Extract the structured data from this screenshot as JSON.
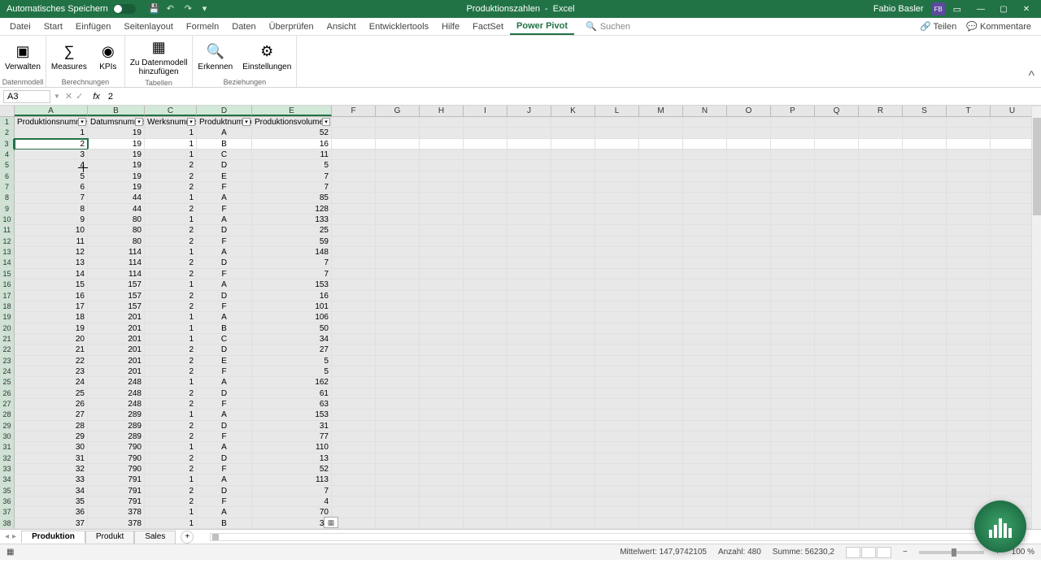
{
  "titlebar": {
    "autosave_label": "Automatisches Speichern",
    "doc_name": "Produktionszahlen",
    "app_name": "Excel",
    "user_name": "Fabio Basler",
    "user_initials": "FB"
  },
  "menu": {
    "items": [
      "Datei",
      "Start",
      "Einfügen",
      "Seitenlayout",
      "Formeln",
      "Daten",
      "Überprüfen",
      "Ansicht",
      "Entwicklertools",
      "Hilfe",
      "FactSet",
      "Power Pivot"
    ],
    "active": "Power Pivot",
    "search": "Suchen",
    "share": "Teilen",
    "comments": "Kommentare"
  },
  "ribbon": {
    "groups": [
      {
        "label": "Datenmodell",
        "buttons": [
          {
            "label": "Verwalten",
            "icon": "cube"
          }
        ]
      },
      {
        "label": "Berechnungen",
        "buttons": [
          {
            "label": "Measures",
            "icon": "calc"
          },
          {
            "label": "KPIs",
            "icon": "kpi"
          }
        ]
      },
      {
        "label": "Tabellen",
        "buttons": [
          {
            "label": "Zu Datenmodell\nhinzufügen",
            "icon": "table"
          }
        ]
      },
      {
        "label": "Beziehungen",
        "buttons": [
          {
            "label": "Erkennen",
            "icon": "detect"
          },
          {
            "label": "Einstellungen",
            "icon": "gear"
          }
        ]
      }
    ]
  },
  "formula": {
    "cell_ref": "A3",
    "value": "2"
  },
  "columns_data": [
    "A",
    "B",
    "C",
    "D",
    "E"
  ],
  "columns_blank": [
    "F",
    "G",
    "H",
    "I",
    "J",
    "K",
    "L",
    "M",
    "N",
    "O",
    "P",
    "Q",
    "R",
    "S",
    "T",
    "U"
  ],
  "col_widths": {
    "A": 90,
    "B": 70,
    "C": 64,
    "D": 68,
    "E": 98,
    "default": 54
  },
  "headers": [
    "Produktionsnummer",
    "Datumsnummer",
    "Werksnummer",
    "Produktnummer",
    "Produktionsvolumen"
  ],
  "active_row": 3,
  "chart_data": {
    "type": "table",
    "columns": [
      "Produktionsnummer",
      "Datumsnummer",
      "Werksnummer",
      "Produktnummer",
      "Produktionsvolumen"
    ],
    "rows": [
      [
        1,
        19,
        1,
        "A",
        52
      ],
      [
        2,
        19,
        1,
        "B",
        16
      ],
      [
        3,
        19,
        1,
        "C",
        11
      ],
      [
        4,
        19,
        2,
        "D",
        5
      ],
      [
        5,
        19,
        2,
        "E",
        7
      ],
      [
        6,
        19,
        2,
        "F",
        7
      ],
      [
        7,
        44,
        1,
        "A",
        85
      ],
      [
        8,
        44,
        2,
        "F",
        128
      ],
      [
        9,
        80,
        1,
        "A",
        133
      ],
      [
        10,
        80,
        2,
        "D",
        25
      ],
      [
        11,
        80,
        2,
        "F",
        59
      ],
      [
        12,
        114,
        1,
        "A",
        148
      ],
      [
        13,
        114,
        2,
        "D",
        7
      ],
      [
        14,
        114,
        2,
        "F",
        7
      ],
      [
        15,
        157,
        1,
        "A",
        153
      ],
      [
        16,
        157,
        2,
        "D",
        16
      ],
      [
        17,
        157,
        2,
        "F",
        101
      ],
      [
        18,
        201,
        1,
        "A",
        106
      ],
      [
        19,
        201,
        1,
        "B",
        50
      ],
      [
        20,
        201,
        1,
        "C",
        34
      ],
      [
        21,
        201,
        2,
        "D",
        27
      ],
      [
        22,
        201,
        2,
        "E",
        5
      ],
      [
        23,
        201,
        2,
        "F",
        5
      ],
      [
        24,
        248,
        1,
        "A",
        162
      ],
      [
        25,
        248,
        2,
        "D",
        61
      ],
      [
        26,
        248,
        2,
        "F",
        63
      ],
      [
        27,
        289,
        1,
        "A",
        153
      ],
      [
        28,
        289,
        2,
        "D",
        31
      ],
      [
        29,
        289,
        2,
        "F",
        77
      ],
      [
        30,
        790,
        1,
        "A",
        110
      ],
      [
        31,
        790,
        2,
        "D",
        13
      ],
      [
        32,
        790,
        2,
        "F",
        52
      ],
      [
        33,
        791,
        1,
        "A",
        113
      ],
      [
        34,
        791,
        2,
        "D",
        7
      ],
      [
        35,
        791,
        2,
        "F",
        4
      ],
      [
        36,
        378,
        1,
        "A",
        70
      ],
      [
        37,
        378,
        1,
        "B",
        34
      ]
    ]
  },
  "sheets": {
    "tabs": [
      "Produktion",
      "Produkt",
      "Sales"
    ],
    "active": "Produktion"
  },
  "status": {
    "avg_label": "Mittelwert:",
    "avg": "147,9742105",
    "count_label": "Anzahl:",
    "count": "480",
    "sum_label": "Summe:",
    "sum": "56230,2",
    "zoom": "100 %"
  }
}
